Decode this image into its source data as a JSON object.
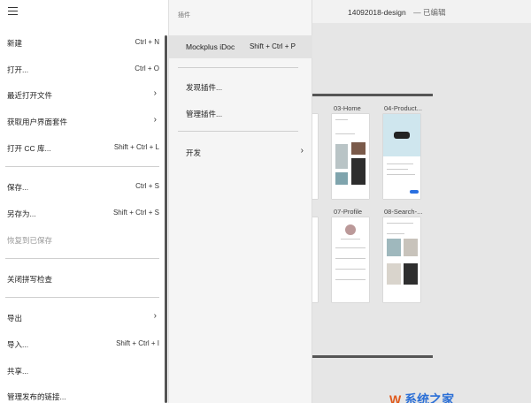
{
  "doc": {
    "filename": "14092018-design",
    "status": "— 已编辑"
  },
  "artboards": {
    "home": "03-Home",
    "product": "04-Product...",
    "profile": "07-Profile",
    "search": "08-Search-..."
  },
  "main_menu": {
    "items": [
      {
        "label": "新建",
        "shortcut": "Ctrl + N"
      },
      {
        "label": "打开...",
        "shortcut": "Ctrl + O"
      },
      {
        "label": "最近打开文件",
        "shortcut": ""
      },
      {
        "label": "获取用户界面套件",
        "shortcut": ""
      },
      {
        "label": "打开 CC 库...",
        "shortcut": "Shift + Ctrl + L"
      },
      {
        "label": "保存...",
        "shortcut": "Ctrl + S"
      },
      {
        "label": "另存为...",
        "shortcut": "Shift + Ctrl + S"
      },
      {
        "label": "恢复到已保存",
        "shortcut": ""
      },
      {
        "label": "关闭拼写检查",
        "shortcut": ""
      },
      {
        "label": "导出",
        "shortcut": ""
      },
      {
        "label": "导入...",
        "shortcut": "Shift + Ctrl + I"
      },
      {
        "label": "共享...",
        "shortcut": ""
      },
      {
        "label": "管理发布的链接...",
        "shortcut": ""
      }
    ]
  },
  "plugin_menu": {
    "header": "插件",
    "items": [
      {
        "label": "Mockplus iDoc",
        "shortcut": "Shift + Ctrl + P"
      },
      {
        "label": "发现插件...",
        "shortcut": ""
      },
      {
        "label": "管理插件...",
        "shortcut": ""
      },
      {
        "label": "开发",
        "shortcut": ""
      }
    ]
  },
  "icons": {
    "menu": "hamburger-icon",
    "submenu": "chevron-right-icon"
  },
  "watermark": {
    "logo_a": "W",
    "logo_b": "系统之家"
  }
}
